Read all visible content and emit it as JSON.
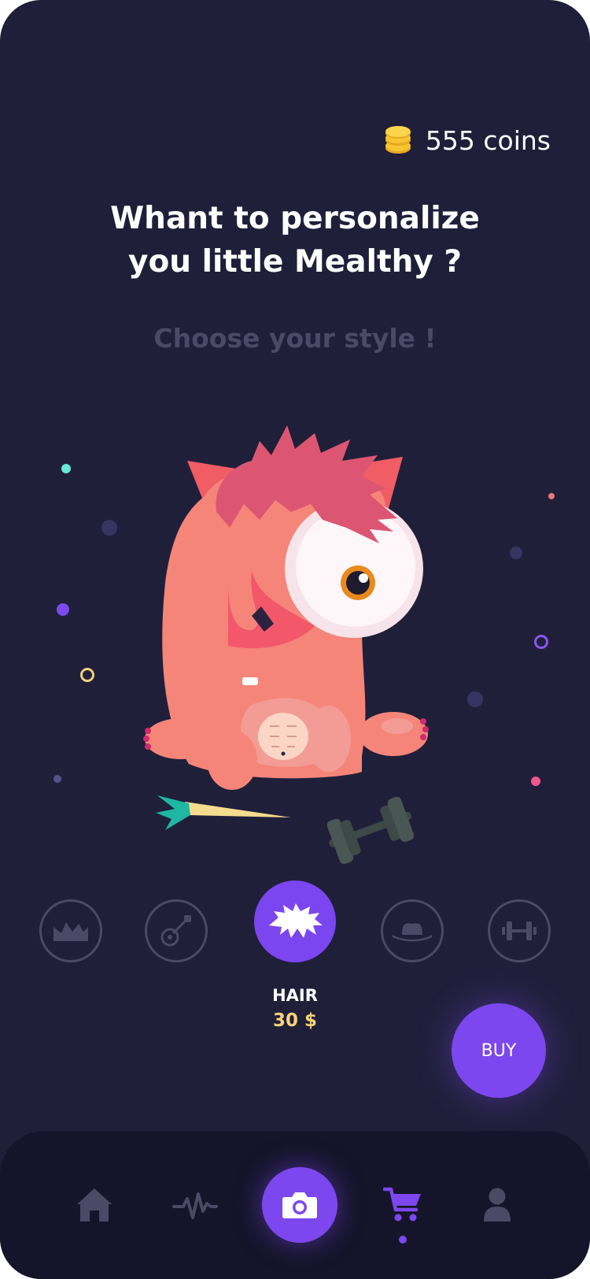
{
  "header": {
    "coins_label": "555 coins",
    "title_line1": "Whant to personalize",
    "title_line2": "you little Mealthy ?",
    "subtitle": "Choose your style !"
  },
  "customization": {
    "categories": [
      {
        "name": "crown",
        "icon": "crown-icon",
        "active": false
      },
      {
        "name": "guitar",
        "icon": "guitar-icon",
        "active": false
      },
      {
        "name": "hair",
        "icon": "hair-icon",
        "active": true
      },
      {
        "name": "hat",
        "icon": "hat-icon",
        "active": false
      },
      {
        "name": "dumbbell",
        "icon": "dumbbell-icon",
        "active": false
      }
    ],
    "selected_name": "HAIR",
    "selected_price": "30 $"
  },
  "buy_label": "BUY",
  "nav": {
    "items": [
      "home-icon",
      "activity-icon",
      "camera-icon",
      "cart-icon",
      "profile-icon"
    ],
    "active": "cart-icon"
  },
  "colors": {
    "background": "#201f3a",
    "accent": "#7c47ee",
    "price": "#f6d27a",
    "navbar": "#15142a",
    "inactive_icon": "#4a4a66"
  }
}
